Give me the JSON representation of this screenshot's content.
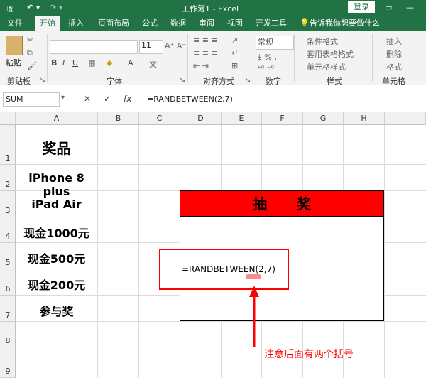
{
  "titlebar": {
    "title": "工作簿1  -  Excel",
    "login": "登录"
  },
  "menu": [
    "文件",
    "开始",
    "插入",
    "页面布局",
    "公式",
    "数据",
    "审阅",
    "视图",
    "开发工具"
  ],
  "menu_tell": "告诉我你想要做什么",
  "ribbon": {
    "groups": [
      "剪贴板",
      "字体",
      "对齐方式",
      "数字",
      "样式",
      "单元格"
    ],
    "paste_label": "粘贴",
    "font_size": "11",
    "number_format": "常规",
    "style_items": [
      "条件格式",
      "套用表格格式",
      "单元格样式"
    ],
    "cell_items": [
      "插入",
      "删除",
      "格式"
    ]
  },
  "formula_bar": {
    "name_box": "SUM",
    "formula": "=RANDBETWEEN(2,7)"
  },
  "columns": [
    "A",
    "B",
    "C",
    "D",
    "E",
    "F",
    "G",
    "H"
  ],
  "rows": [
    "1",
    "2",
    "3",
    "4",
    "5",
    "6",
    "7",
    "8",
    "9"
  ],
  "cells_A": [
    "奖品",
    "iPhone 8 plus",
    "iPad Air",
    "现金1000元",
    "现金500元",
    "现金200元",
    "参与奖"
  ],
  "lottery": {
    "title": "抽      奖",
    "cell_formula": "=RANDBETWEEN(2,7)"
  },
  "annotation": "注意后面有两个括号",
  "colors": {
    "excel_green": "#217346",
    "header_red": "#ff0000",
    "annotation_red": "#ff0000"
  }
}
